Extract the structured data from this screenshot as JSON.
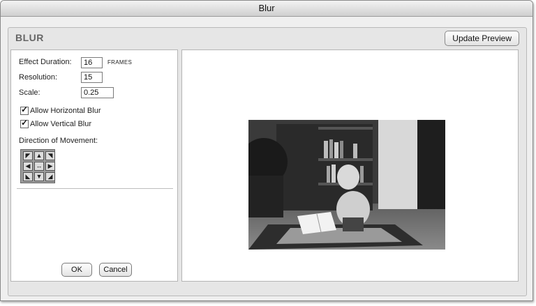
{
  "window": {
    "title": "Blur"
  },
  "panel": {
    "heading": "BLUR",
    "update_label": "Update Preview"
  },
  "fields": {
    "effect_duration": {
      "label": "Effect Duration:",
      "value": "16",
      "unit": "FRAMES"
    },
    "resolution": {
      "label": "Resolution:",
      "value": "15"
    },
    "scale": {
      "label": "Scale:",
      "value": "0.25"
    }
  },
  "checkboxes": [
    {
      "label": "Allow Horizontal Blur",
      "checked": true
    },
    {
      "label": "Allow Vertical Blur",
      "checked": true
    }
  ],
  "direction": {
    "label": "Direction of Movement:",
    "arrows": [
      "◤",
      "▲",
      "◥",
      "◀",
      "↔",
      "▶",
      "◣",
      "▼",
      "◢"
    ],
    "icon_names": [
      "arrow-up-left-icon",
      "arrow-up-icon",
      "arrow-up-right-icon",
      "arrow-left-icon",
      "arrow-center-icon",
      "arrow-right-icon",
      "arrow-down-left-icon",
      "arrow-down-icon",
      "arrow-down-right-icon"
    ]
  },
  "buttons": {
    "ok": "OK",
    "cancel": "Cancel"
  }
}
